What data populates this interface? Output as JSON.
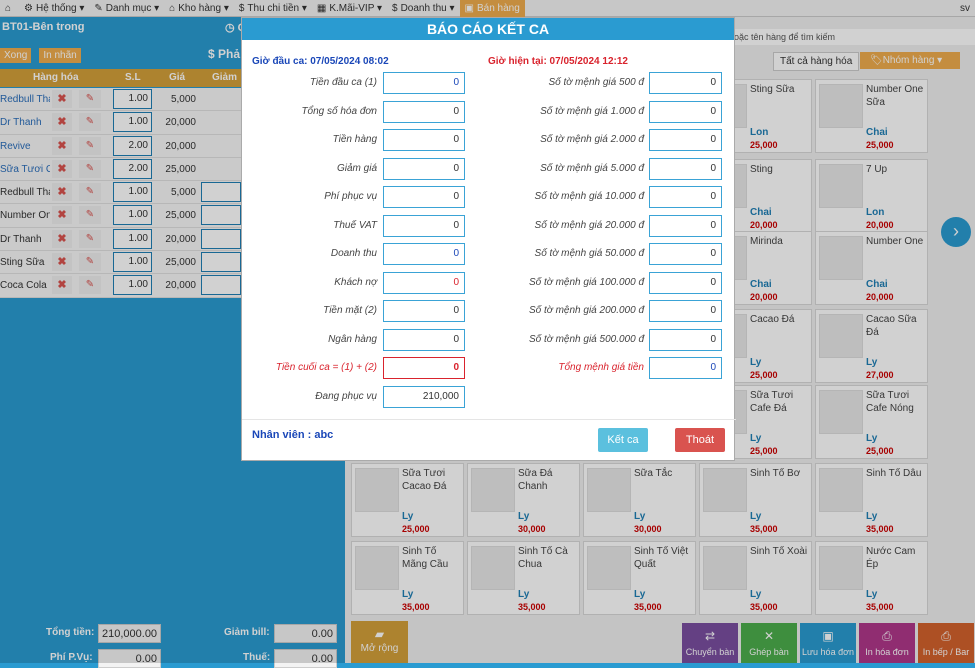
{
  "nav": {
    "items": [
      {
        "icon": "⌂",
        "label": ""
      },
      {
        "icon": "⚙",
        "label": "Hệ thống ▾"
      },
      {
        "icon": "✎",
        "label": "Danh mục ▾"
      },
      {
        "icon": "⌂",
        "label": "Kho hàng ▾"
      },
      {
        "icon": "$",
        "label": "Thu chi tiền ▾"
      },
      {
        "icon": "▦",
        "label": "K.Mãi-VIP ▾"
      },
      {
        "icon": "$",
        "label": "Doanh thu ▾"
      },
      {
        "icon": "▣",
        "label": "Bán hàng"
      }
    ],
    "user": "sv"
  },
  "left": {
    "table_title": "BT01-Bên trong",
    "time_label": "◷ C",
    "buttons": {
      "close": "Xong",
      "print": "In nhãn"
    },
    "pay_label": "$ Phả",
    "cols": {
      "name": "Hàng hóa",
      "qty": "S.L",
      "price": "Giá",
      "discount": "Giảm"
    },
    "rows": [
      {
        "name": "Redbull Thái",
        "qty": "1.00",
        "price": "5,000"
      },
      {
        "name": "Dr Thanh",
        "qty": "1.00",
        "price": "20,000"
      },
      {
        "name": "Revive",
        "qty": "2.00",
        "price": "20,000"
      },
      {
        "name": "Sữa Tươi Ca",
        "qty": "2.00",
        "price": "25,000"
      },
      {
        "name": "Redbull Thái",
        "qty": "1.00",
        "price": "5,000"
      },
      {
        "name": "Number One",
        "qty": "1.00",
        "price": "25,000"
      },
      {
        "name": "Dr Thanh",
        "qty": "1.00",
        "price": "20,000"
      },
      {
        "name": "Sting Sữa",
        "qty": "1.00",
        "price": "25,000"
      },
      {
        "name": "Coca Cola",
        "qty": "1.00",
        "price": "20,000"
      }
    ],
    "totals": {
      "total_label": "Tổng tiền:",
      "total": "210,000.00",
      "bill_disc_label": "Giảm bill:",
      "bill_disc": "0.00",
      "service_label": "Phí P.Vụ:",
      "service": "0.00",
      "tax_label": "Thuế:",
      "tax": "0.00"
    }
  },
  "right": {
    "search_placeholder": "oặc tên hàng để tìm kiếm",
    "cat_all": "Tất cả hàng hóa",
    "cat_group": "🏷Nhóm hàng ▾",
    "products": [
      {
        "name": "Sting Sữa",
        "unit": "Lon",
        "price": "25,000"
      },
      {
        "name": "Number One Sữa",
        "unit": "Chai",
        "price": "25,000"
      },
      {
        "name": "Sting",
        "unit": "Chai",
        "price": "20,000"
      },
      {
        "name": "7 Up",
        "unit": "Lon",
        "price": "20,000"
      },
      {
        "name": "Mirinda",
        "unit": "Chai",
        "price": "20,000"
      },
      {
        "name": "Number One",
        "unit": "Chai",
        "price": "20,000"
      },
      {
        "name": "Cacao Đá",
        "unit": "Ly",
        "price": "25,000"
      },
      {
        "name": "Cacao Sữa Đá",
        "unit": "Ly",
        "price": "27,000"
      },
      {
        "name": "Sữa Tươi Cafe Đá",
        "unit": "Ly",
        "price": "25,000"
      },
      {
        "name": "Sữa Tươi Cafe Nóng",
        "unit": "Ly",
        "price": "25,000"
      },
      {
        "name": "Sữa Tươi Cacao Đá",
        "unit": "Ly",
        "price": "25,000"
      },
      {
        "name": "Sữa Đá Chanh",
        "unit": "Ly",
        "price": "30,000"
      },
      {
        "name": "Sữa Tắc",
        "unit": "Ly",
        "price": "30,000"
      },
      {
        "name": "Sinh Tố Bơ",
        "unit": "Ly",
        "price": "35,000"
      },
      {
        "name": "Sinh Tố Dâu",
        "unit": "Ly",
        "price": "35,000"
      },
      {
        "name": "Sinh Tố Mãng Cầu",
        "unit": "Ly",
        "price": "35,000"
      },
      {
        "name": "Sinh Tố Cà Chua",
        "unit": "Ly",
        "price": "35,000"
      },
      {
        "name": "Sinh Tố Việt Quất",
        "unit": "Ly",
        "price": "35,000"
      },
      {
        "name": "Sinh Tố Xoài",
        "unit": "Ly",
        "price": "35,000"
      },
      {
        "name": "Nước Cam Ép",
        "unit": "Ly",
        "price": "35,000"
      }
    ],
    "more_label": "Mở rộng",
    "actions": [
      {
        "label": "Chuyển bàn",
        "icon": "⇄",
        "color": "#7a4fa0"
      },
      {
        "label": "Ghép bàn",
        "icon": "✕",
        "color": "#4cae4c"
      },
      {
        "label": "Lưu hóa đơn",
        "icon": "▣",
        "color": "#2a9bd1"
      },
      {
        "label": "In hóa đơn",
        "icon": "⎙",
        "color": "#b0388a"
      },
      {
        "label": "In bếp / Bar",
        "icon": "⎙",
        "color": "#d4622c"
      }
    ]
  },
  "modal": {
    "title": "BÁO CÁO KẾT CA",
    "start_time": "Giờ đầu ca: 07/05/2024 08:02",
    "current_time": "Giờ hiện tại: 07/05/2024 12:12",
    "left_fields": [
      {
        "label": "Tiền đầu ca (1)",
        "value": "0"
      },
      {
        "label": "Tổng số hóa đơn",
        "value": "0"
      },
      {
        "label": "Tiền hàng",
        "value": "0"
      },
      {
        "label": "Giảm giá",
        "value": "0"
      },
      {
        "label": "Phí phục vụ",
        "value": "0"
      },
      {
        "label": "Thuế VAT",
        "value": "0"
      },
      {
        "label": "Doanh thu",
        "value": "0"
      },
      {
        "label": "Khách nợ",
        "value": "0"
      },
      {
        "label": "Tiền mặt (2)",
        "value": "0"
      },
      {
        "label": "Ngân hàng",
        "value": "0"
      },
      {
        "label": "Tiền cuối ca = (1) + (2)",
        "value": "0"
      },
      {
        "label": "Đang phục vụ",
        "value": "210,000"
      }
    ],
    "right_fields": [
      {
        "label": "Số tờ mệnh giá 500 đ",
        "value": "0"
      },
      {
        "label": "Số tờ mệnh giá 1.000 đ",
        "value": "0"
      },
      {
        "label": "Số tờ mệnh giá 2.000 đ",
        "value": "0"
      },
      {
        "label": "Số tờ mệnh giá 5.000 đ",
        "value": "0"
      },
      {
        "label": "Số tờ mệnh giá 10.000 đ",
        "value": "0"
      },
      {
        "label": "Số tờ mệnh giá 20.000 đ",
        "value": "0"
      },
      {
        "label": "Số tờ mệnh giá 50.000 đ",
        "value": "0"
      },
      {
        "label": "Số tờ mệnh giá 100.000 đ",
        "value": "0"
      },
      {
        "label": "Số tờ mệnh giá 200.000 đ",
        "value": "0"
      },
      {
        "label": "Số tờ mệnh giá 500.000 đ",
        "value": "0"
      },
      {
        "label": "Tổng mệnh giá tiền",
        "value": "0"
      }
    ],
    "employee": "Nhân viên : abc",
    "btn_close_shift": "Kết ca",
    "btn_exit": "Thoát"
  }
}
